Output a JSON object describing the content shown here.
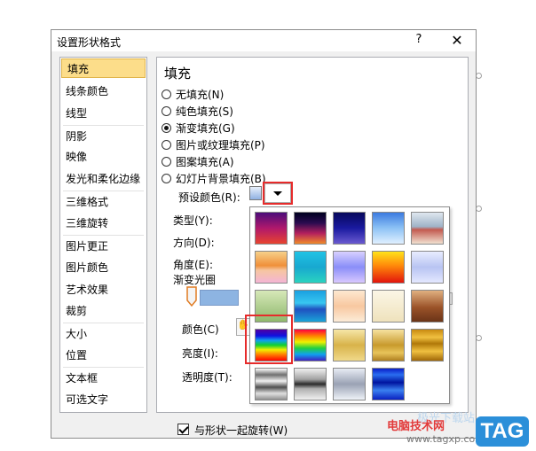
{
  "dialog": {
    "title": "设置形状格式",
    "help": "?",
    "close": "✕"
  },
  "sidebar": {
    "items": [
      {
        "label": "填充",
        "selected": true
      },
      {
        "label": "线条颜色"
      },
      {
        "label": "线型"
      },
      {
        "label": "阴影"
      },
      {
        "label": "映像"
      },
      {
        "label": "发光和柔化边缘"
      },
      {
        "label": "三维格式"
      },
      {
        "label": "三维旋转"
      },
      {
        "label": "图片更正"
      },
      {
        "label": "图片颜色"
      },
      {
        "label": "艺术效果"
      },
      {
        "label": "裁剪"
      },
      {
        "label": "大小"
      },
      {
        "label": "位置"
      },
      {
        "label": "文本框"
      },
      {
        "label": "可选文字"
      }
    ]
  },
  "fill": {
    "heading": "填充",
    "options": [
      {
        "label": "无填充(N)",
        "checked": false
      },
      {
        "label": "纯色填充(S)",
        "checked": false
      },
      {
        "label": "渐变填充(G)",
        "checked": true
      },
      {
        "label": "图片或纹理填充(P)",
        "checked": false
      },
      {
        "label": "图案填充(A)",
        "checked": false
      },
      {
        "label": "幻灯片背景填充(B)",
        "checked": false
      }
    ],
    "preset_label": "预设颜色(R):",
    "type_label": "类型(Y):",
    "direction_label": "方向(D):",
    "angle_label": "角度(E):",
    "stops_label": "渐变光圈",
    "color_label": "颜色(C)",
    "brightness_label": "亮度(I):",
    "transparency_label": "透明度(T):",
    "rotate_label": "与形状一起旋转(W)",
    "rotate_checked": true
  },
  "preset_gallery": {
    "swatches": [
      "late-sunset",
      "nightfall",
      "daybreak",
      "horizon",
      "desert",
      "early-sunset",
      "ocean",
      "calm-water",
      "fire",
      "fog",
      "moss",
      "peacock",
      "wheat",
      "parchment",
      "mahogany",
      "rainbow",
      "rainbow-ii",
      "gold",
      "gold-ii",
      "brass",
      "chrome",
      "chrome-ii",
      "silver",
      "sapphire"
    ],
    "highlighted": "rainbow"
  },
  "watermark": {
    "text": "电脑技术网",
    "url": "www.tagxp.com",
    "tag": "TAG"
  },
  "colors": {
    "highlight": "#e62b2b",
    "selected_item": "#fcdd8a"
  }
}
